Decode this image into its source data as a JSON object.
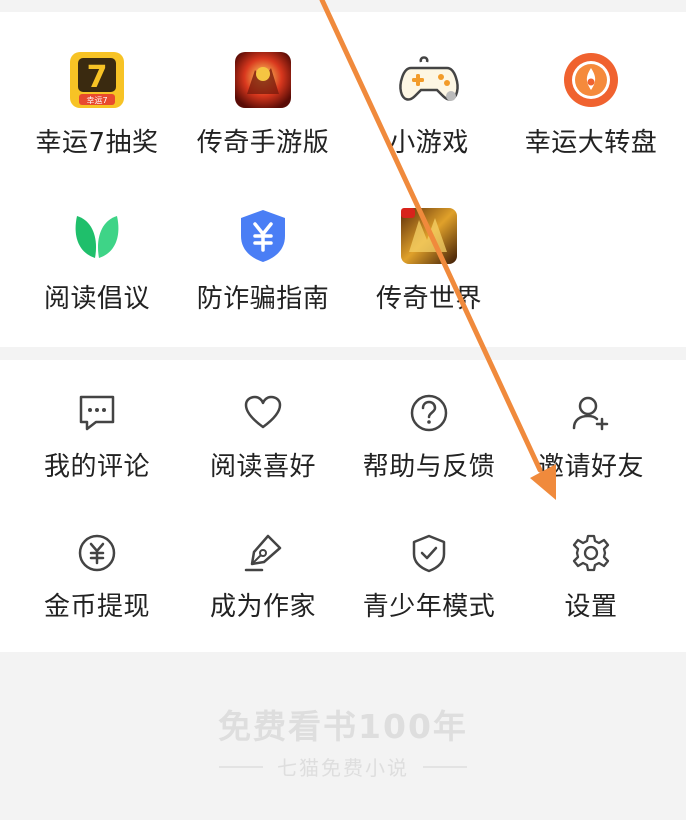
{
  "apps": [
    {
      "label": "幸运7抽奖",
      "icon": "lucky-seven-icon",
      "badge": "幸运7"
    },
    {
      "label": "传奇手游版",
      "icon": "legend-game-icon"
    },
    {
      "label": "小游戏",
      "icon": "gamepad-icon"
    },
    {
      "label": "幸运大转盘",
      "icon": "lucky-wheel-icon"
    },
    {
      "label": "阅读倡议",
      "icon": "leaf-icon"
    },
    {
      "label": "防诈骗指南",
      "icon": "shield-yuan-icon"
    },
    {
      "label": "传奇世界",
      "icon": "legend-world-icon"
    }
  ],
  "tools": [
    {
      "label": "我的评论",
      "icon": "comment-icon"
    },
    {
      "label": "阅读喜好",
      "icon": "heart-icon"
    },
    {
      "label": "帮助与反馈",
      "icon": "help-icon"
    },
    {
      "label": "邀请好友",
      "icon": "add-user-icon"
    },
    {
      "label": "金币提现",
      "icon": "coin-yuan-icon"
    },
    {
      "label": "成为作家",
      "icon": "pen-icon"
    },
    {
      "label": "青少年模式",
      "icon": "shield-check-icon"
    },
    {
      "label": "设置",
      "icon": "gear-icon"
    }
  ],
  "footer": {
    "slogan": "免费看书100年",
    "brand": "七猫免费小说"
  },
  "colors": {
    "arrow": "#f08a3c",
    "page_bg": "#f3f3f3",
    "card_bg": "#ffffff",
    "text": "#222222",
    "icon_stroke": "#444444"
  }
}
